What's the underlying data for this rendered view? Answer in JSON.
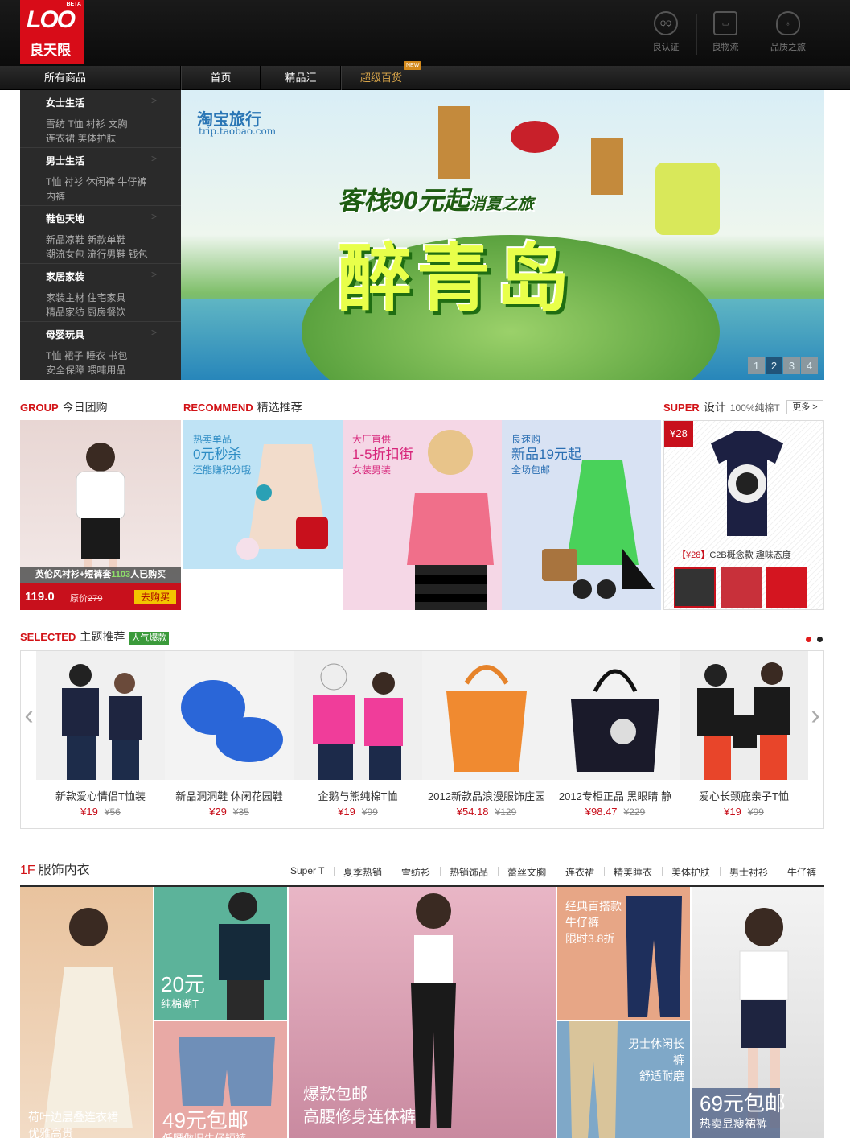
{
  "header": {
    "logo_text": "LOO",
    "logo_cn": "良天限",
    "logo_badge": "BETA",
    "icons": [
      {
        "label": "良认证",
        "icon": "certification-icon"
      },
      {
        "label": "良物流",
        "icon": "truck-icon"
      },
      {
        "label": "品质之旅",
        "icon": "balloon-icon"
      }
    ]
  },
  "nav": {
    "all": "所有商品",
    "items": [
      "首页",
      "精品汇",
      "超级百货"
    ],
    "new_badge": "NEW"
  },
  "sidebar": {
    "categories": [
      {
        "title": "女士生活",
        "lines": [
          "雪纺 T恤 衬衫 文胸",
          "连衣裙 美体护肤"
        ]
      },
      {
        "title": "男士生活",
        "lines": [
          "T恤 衬衫 休闲裤 牛仔裤",
          "内裤"
        ]
      },
      {
        "title": "鞋包天地",
        "lines": [
          "新品凉鞋 新款单鞋",
          "潮流女包 流行男鞋 钱包"
        ]
      },
      {
        "title": "家居家装",
        "lines": [
          "家装主材 住宅家具",
          "精品家纺 厨房餐饮"
        ]
      },
      {
        "title": "母婴玩具",
        "lines": [
          "T恤 裙子 睡衣 书包",
          "安全保障 喂哺用品"
        ]
      }
    ]
  },
  "banner": {
    "brand": "淘宝旅行",
    "brand_url": "trip.taobao.com",
    "subtitle": "客栈90元起",
    "subtitle2": "消夏之旅",
    "title": "醉青岛",
    "pages": [
      "1",
      "2",
      "3",
      "4"
    ],
    "active_page": "2"
  },
  "group": {
    "heading_en": "GROUP",
    "heading_cn": "今日团购",
    "caption_pre": "英伦风衬衫+短裤套",
    "caption_count": "1103",
    "caption_post": "人已购买",
    "price": "119.0",
    "orig_label": "原价",
    "orig_price": "279",
    "buy_label": "去购买"
  },
  "recommend": {
    "heading_en": "RECOMMEND",
    "heading_cn": "精选推荐",
    "cards": [
      {
        "line1": "热卖单品",
        "line2": "0元秒杀",
        "line3": "还能赚积分哦",
        "bg": "#bfe3f5",
        "color": "#2d8cc4"
      },
      {
        "line1": "大厂直供",
        "line2": "1-5折扣街",
        "line3": "女装男装",
        "bg": "#f5d7e6",
        "color": "#d7247a"
      },
      {
        "line1": "良速购",
        "line2": "新品19元起",
        "line3": "全场包邮",
        "bg": "#d8e2f3",
        "color": "#2b6fb3"
      }
    ]
  },
  "super": {
    "heading_en": "SUPER",
    "heading_cn": "设计",
    "heading_sub": "100%纯棉T",
    "more_label": "更多 >",
    "price_badge": "¥28",
    "caption_price": "【¥28】",
    "caption_text": "C2B概念款 趣味态度"
  },
  "selected": {
    "heading_en": "SELECTED",
    "heading_cn": "主题推荐",
    "badge": "人气爆款",
    "items": [
      {
        "name": "新款爱心情侣T恤装",
        "price": "¥19",
        "orig": "¥56"
      },
      {
        "name": "新品洞洞鞋 休闲花园鞋",
        "price": "¥29",
        "orig": "¥35"
      },
      {
        "name": "企鹅与熊纯棉T恤",
        "price": "¥19",
        "orig": "¥99"
      },
      {
        "name": "2012新款品浪漫服饰庄园",
        "price": "¥54.18",
        "orig": "¥129"
      },
      {
        "name": "2012专柜正品 黑眼睛 静",
        "price": "¥98.47",
        "orig": "¥229"
      },
      {
        "name": "爱心长颈鹿亲子T恤",
        "price": "¥19",
        "orig": "¥99"
      }
    ]
  },
  "floor": {
    "num": "1F",
    "title": "服饰内衣",
    "tabs": [
      "Super T",
      "夏季热销",
      "雪纺衫",
      "热销饰品",
      "蕾丝文胸",
      "连衣裙",
      "精美睡衣",
      "美体护肤",
      "男士衬衫",
      "牛仔裤"
    ],
    "tiles": {
      "dress": [
        "荷叶边层叠连衣裙",
        "优雅高贵"
      ],
      "tee_price": "20元",
      "tee_label": "纯棉潮T",
      "shorts_price": "49元包邮",
      "shorts_label": "低腰做旧牛仔短裤",
      "jumpsuit": [
        "爆款包邮",
        "高腰修身连体裤"
      ],
      "jeans": [
        "经典百搭款",
        "牛仔裤",
        "限时3.8折"
      ],
      "khaki": [
        "男士休闲长裤",
        "舒适耐磨"
      ],
      "skirt_price": "69元包邮",
      "skirt_label": "热卖显瘦裙裤"
    }
  }
}
